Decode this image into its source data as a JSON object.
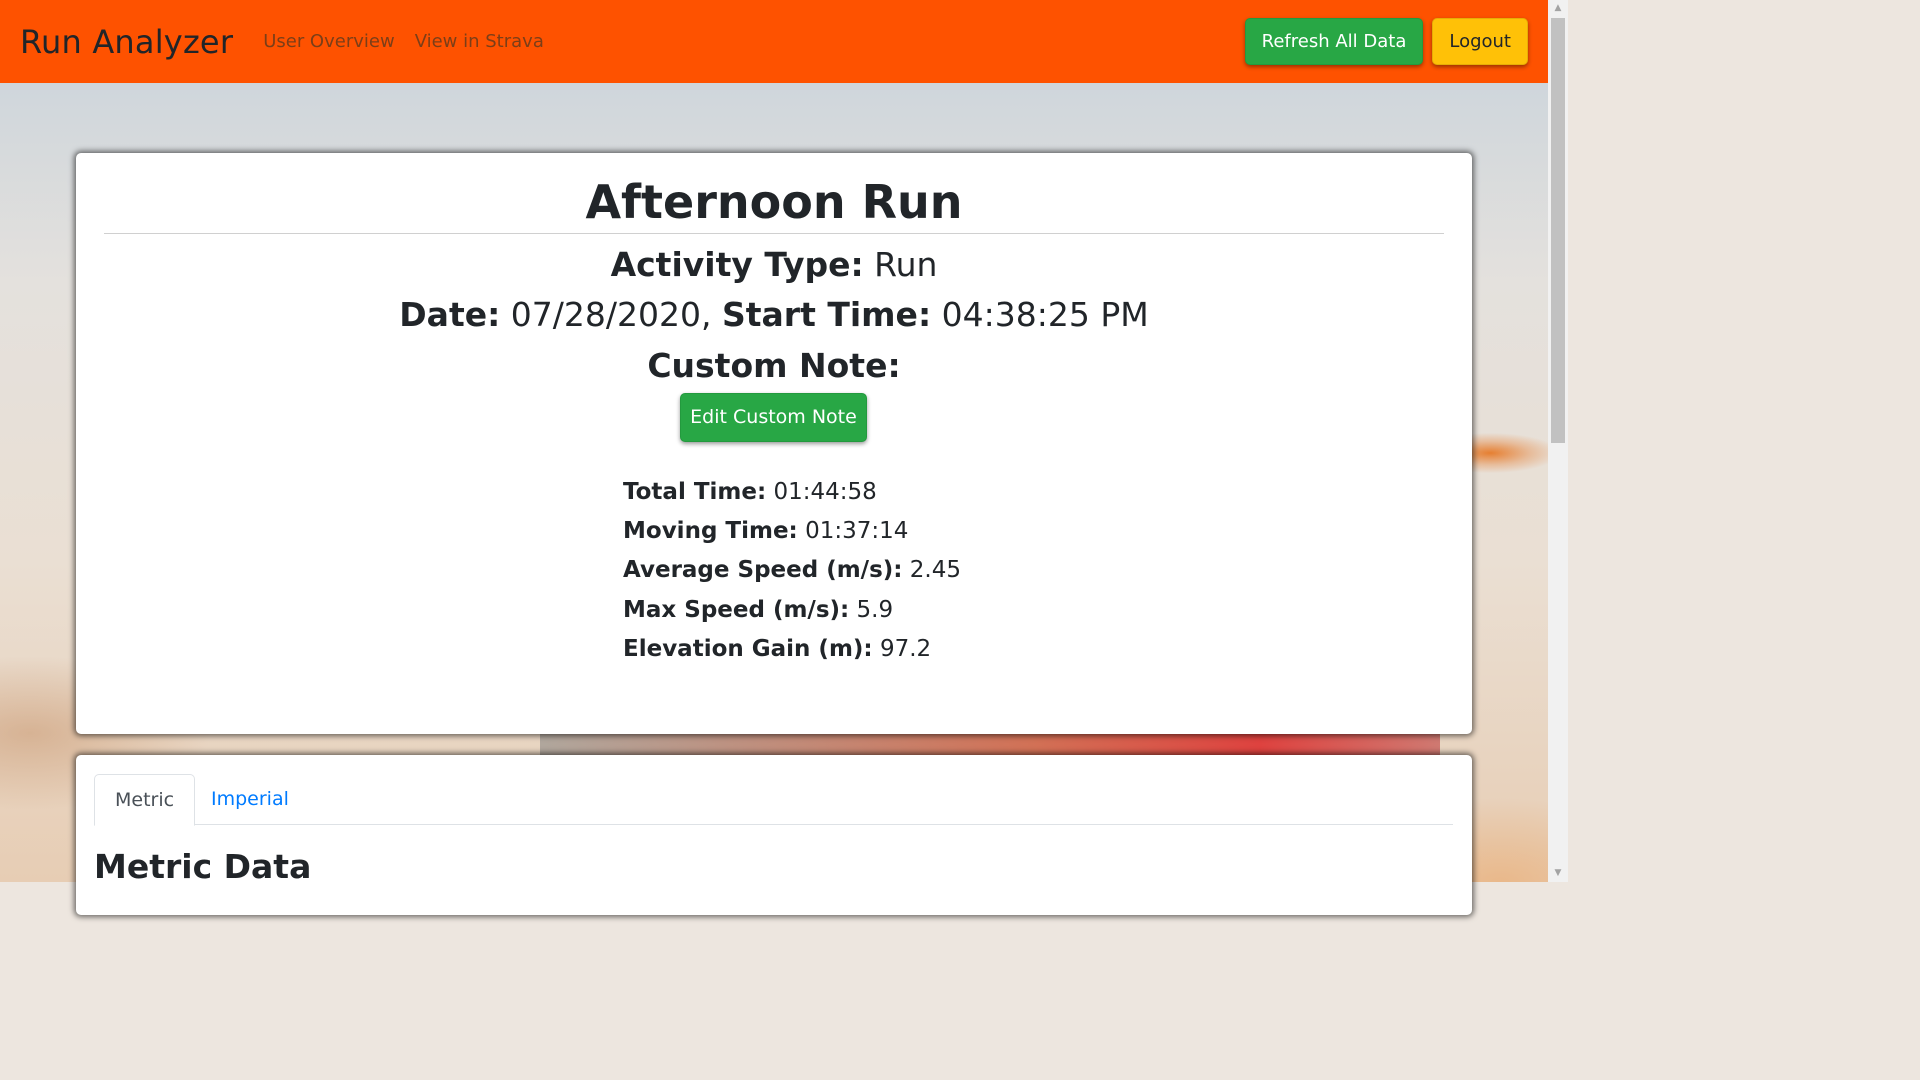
{
  "navbar": {
    "brand": "Run Analyzer",
    "links": [
      "User Overview",
      "View in Strava"
    ],
    "refresh_label": "Refresh All Data",
    "logout_label": "Logout"
  },
  "activity": {
    "title": "Afternoon Run",
    "type_label": "Activity Type:",
    "type_value": "Run",
    "date_label": "Date:",
    "date_value": "07/28/2020,",
    "start_label": "Start Time:",
    "start_value": "04:38:25 PM",
    "custom_note_label": "Custom Note:",
    "edit_note_label": "Edit Custom Note",
    "stats": [
      {
        "label": "Total Time:",
        "value": "01:44:58"
      },
      {
        "label": "Moving Time:",
        "value": "01:37:14"
      },
      {
        "label": "Average Speed (m/s):",
        "value": "2.45"
      },
      {
        "label": "Max Speed (m/s):",
        "value": "5.9"
      },
      {
        "label": "Elevation Gain (m):",
        "value": "97.2"
      }
    ]
  },
  "data_section": {
    "tabs": [
      "Metric",
      "Imperial"
    ],
    "active_tab": "Metric",
    "title": "Metric Data"
  },
  "colors": {
    "navbar": "#fe5200",
    "success": "#28a745",
    "warning": "#ffc107",
    "link": "#007bff"
  }
}
